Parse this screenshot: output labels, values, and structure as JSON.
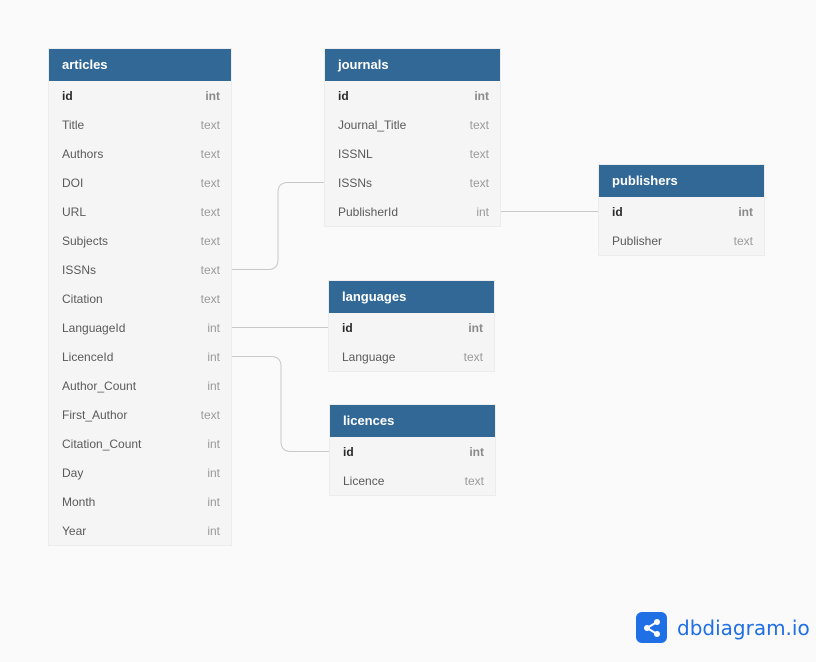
{
  "diagram": {
    "tables": [
      {
        "key": "articles",
        "name": "articles",
        "fields": [
          {
            "name": "id",
            "type": "int",
            "pk": true
          },
          {
            "name": "Title",
            "type": "text"
          },
          {
            "name": "Authors",
            "type": "text"
          },
          {
            "name": "DOI",
            "type": "text"
          },
          {
            "name": "URL",
            "type": "text"
          },
          {
            "name": "Subjects",
            "type": "text"
          },
          {
            "name": "ISSNs",
            "type": "text"
          },
          {
            "name": "Citation",
            "type": "text"
          },
          {
            "name": "LanguageId",
            "type": "int"
          },
          {
            "name": "LicenceId",
            "type": "int"
          },
          {
            "name": "Author_Count",
            "type": "int"
          },
          {
            "name": "First_Author",
            "type": "text"
          },
          {
            "name": "Citation_Count",
            "type": "int"
          },
          {
            "name": "Day",
            "type": "int"
          },
          {
            "name": "Month",
            "type": "int"
          },
          {
            "name": "Year",
            "type": "int"
          }
        ]
      },
      {
        "key": "journals",
        "name": "journals",
        "fields": [
          {
            "name": "id",
            "type": "int",
            "pk": true
          },
          {
            "name": "Journal_Title",
            "type": "text"
          },
          {
            "name": "ISSNL",
            "type": "text"
          },
          {
            "name": "ISSNs",
            "type": "text"
          },
          {
            "name": "PublisherId",
            "type": "int"
          }
        ]
      },
      {
        "key": "publishers",
        "name": "publishers",
        "fields": [
          {
            "name": "id",
            "type": "int",
            "pk": true
          },
          {
            "name": "Publisher",
            "type": "text"
          }
        ]
      },
      {
        "key": "languages",
        "name": "languages",
        "fields": [
          {
            "name": "id",
            "type": "int",
            "pk": true
          },
          {
            "name": "Language",
            "type": "text"
          }
        ]
      },
      {
        "key": "licences",
        "name": "licences",
        "fields": [
          {
            "name": "id",
            "type": "int",
            "pk": true
          },
          {
            "name": "Licence",
            "type": "text"
          }
        ]
      }
    ],
    "relationships": [
      {
        "from": "articles.ISSNs",
        "to": "journals.ISSNs"
      },
      {
        "from": "articles.LanguageId",
        "to": "languages.id"
      },
      {
        "from": "articles.LicenceId",
        "to": "licences.id"
      },
      {
        "from": "journals.PublisherId",
        "to": "publishers.id"
      }
    ]
  },
  "colors": {
    "header_bg": "#316896",
    "header_text": "#ffffff",
    "body_bg": "#f5f5f5",
    "connector": "#c8c8c8",
    "brand": "#1f6fe5"
  },
  "branding": {
    "name": "dbdiagram.io",
    "icon": "share-nodes-icon"
  }
}
